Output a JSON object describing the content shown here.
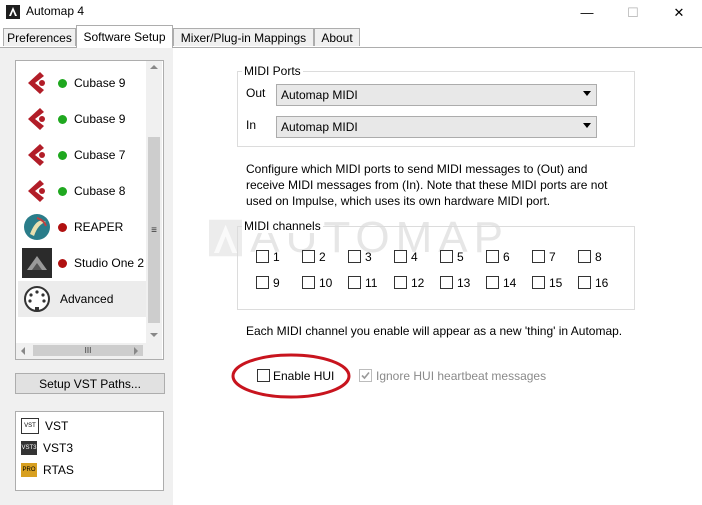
{
  "window": {
    "title": "Automap 4",
    "controls": [
      "—",
      "☐",
      "✕"
    ]
  },
  "tabs": [
    {
      "label": "Preferences",
      "active": false
    },
    {
      "label": "Software Setup",
      "active": true
    },
    {
      "label": "Mixer/Plug-in Mappings",
      "active": false
    },
    {
      "label": "About",
      "active": false
    }
  ],
  "daw_list": [
    {
      "label": "Cubase 9",
      "status": "green",
      "icon": "cubase-icon"
    },
    {
      "label": "Cubase 9",
      "status": "green",
      "icon": "cubase-icon"
    },
    {
      "label": "Cubase 7",
      "status": "green",
      "icon": "cubase-icon"
    },
    {
      "label": "Cubase 8",
      "status": "green",
      "icon": "cubase-icon"
    },
    {
      "label": "REAPER",
      "status": "red",
      "icon": "reaper-icon"
    },
    {
      "label": "Studio One 2",
      "status": "red",
      "icon": "studio-one-icon"
    },
    {
      "label": "Advanced",
      "status": "",
      "icon": "midi-din-icon"
    }
  ],
  "scroll": {
    "hthumb": "III",
    "vthumb": "≡"
  },
  "setup_vst_button": "Setup VST Paths...",
  "plugin_formats": [
    {
      "label": "VST",
      "icon": "vst-icon"
    },
    {
      "label": "VST3",
      "icon": "vst3-icon"
    },
    {
      "label": "RTAS",
      "icon": "rtas-icon"
    }
  ],
  "midi_ports": {
    "title": "MIDI Ports",
    "out_label": "Out",
    "out_value": "Automap MIDI",
    "in_label": "In",
    "in_value": "Automap MIDI"
  },
  "description": "Configure which MIDI ports to send MIDI messages to (Out) and receive MIDI messages from (In). Note that these MIDI ports are not used on Impulse, which uses its own hardware MIDI port.",
  "midi_channels": {
    "title": "MIDI channels",
    "channels": [
      "1",
      "2",
      "3",
      "4",
      "5",
      "6",
      "7",
      "8",
      "9",
      "10",
      "11",
      "12",
      "13",
      "14",
      "15",
      "16"
    ]
  },
  "watermark": "AUTOMAP",
  "channel_note": "Each MIDI channel you enable will appear as a new 'thing' in Automap.",
  "enable_hui": {
    "label": "Enable HUI",
    "checked": false
  },
  "ignore_hui": {
    "label": "Ignore HUI heartbeat messages",
    "checked": true,
    "disabled": true
  },
  "colors": {
    "status_green": "#1fa81f",
    "status_red": "#b01010",
    "highlight_circle": "#c8141e"
  }
}
